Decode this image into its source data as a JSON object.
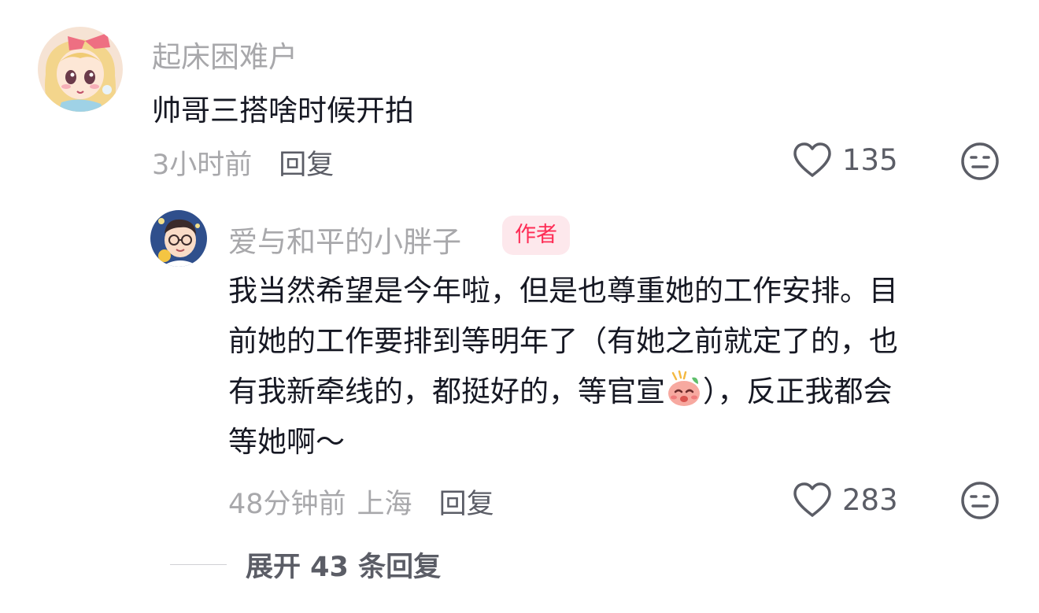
{
  "comment": {
    "username": "起床困难户",
    "text": "帅哥三搭啥时候开拍",
    "time": "3小时前",
    "reply_label": "回复",
    "like_count": "135"
  },
  "reply": {
    "username": "爱与和平的小胖子",
    "badge": "作者",
    "lines": [
      "我当然希望是今年啦，但是也尊重她的工作安排。目",
      "前她的工作要排到等明年了（有她之前就定了的，也",
      "有我新牵线的，都挺好的，等官宣",
      "），反正我都会",
      "等她啊～"
    ],
    "time": "48分钟前",
    "location": "上海",
    "reply_label": "回复",
    "like_count": "283"
  },
  "expand_label": "展开 43 条回复",
  "icons": {
    "like": "heart-outline-icon",
    "dislike": "meh-face-icon",
    "inline_emoji": "shy-face-emoji"
  },
  "colors": {
    "badge_text": "#fe2c55",
    "badge_bg": "#fde8ec"
  }
}
